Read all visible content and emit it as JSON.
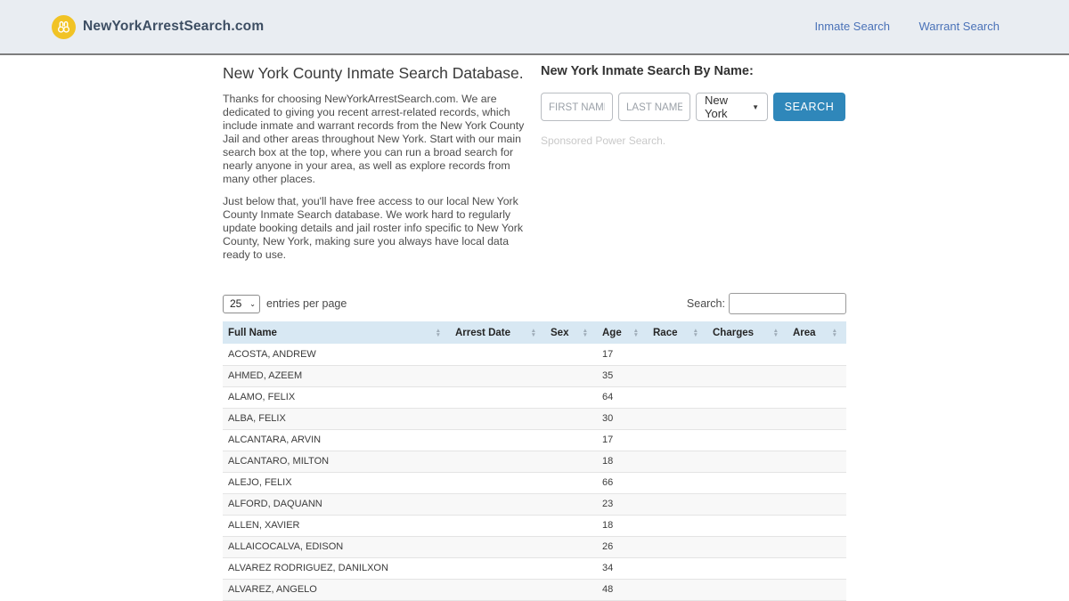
{
  "header": {
    "brand": "NewYorkArrestSearch.com",
    "nav": [
      {
        "label": "Inmate Search"
      },
      {
        "label": "Warrant Search"
      }
    ]
  },
  "intro": {
    "title": "New York County Inmate Search Database.",
    "paragraph1": "Thanks for choosing NewYorkArrestSearch.com. We are dedicated to giving you recent arrest-related records, which include inmate and warrant records from the New York County Jail and other areas throughout New York. Start with our main search box at the top, where you can run a broad search for nearly anyone in your area, as well as explore records from many other places.",
    "paragraph2": "Just below that, you'll have free access to our local New York County Inmate Search database. We work hard to regularly update booking details and jail roster info specific to New York County, New York, making sure you always have local data ready to use."
  },
  "search_form": {
    "title": "New York Inmate Search By Name:",
    "first_name_placeholder": "FIRST NAME",
    "last_name_placeholder": "LAST NAME",
    "state_selected": "New York",
    "search_button": "SEARCH",
    "sponsored": "Sponsored Power Search."
  },
  "table_controls": {
    "page_size": "25",
    "entries_label": "entries per page",
    "search_label": "Search:",
    "search_value": ""
  },
  "table": {
    "columns": [
      "Full Name",
      "Arrest Date",
      "Sex",
      "Age",
      "Race",
      "Charges",
      "Area"
    ],
    "rows": [
      {
        "full_name": "ACOSTA, ANDREW",
        "arrest_date": "",
        "sex": "",
        "age": "17",
        "race": "",
        "charges": "",
        "area": ""
      },
      {
        "full_name": "AHMED, AZEEM",
        "arrest_date": "",
        "sex": "",
        "age": "35",
        "race": "",
        "charges": "",
        "area": ""
      },
      {
        "full_name": "ALAMO, FELIX",
        "arrest_date": "",
        "sex": "",
        "age": "64",
        "race": "",
        "charges": "",
        "area": ""
      },
      {
        "full_name": "ALBA, FELIX",
        "arrest_date": "",
        "sex": "",
        "age": "30",
        "race": "",
        "charges": "",
        "area": ""
      },
      {
        "full_name": "ALCANTARA, ARVIN",
        "arrest_date": "",
        "sex": "",
        "age": "17",
        "race": "",
        "charges": "",
        "area": ""
      },
      {
        "full_name": "ALCANTARO, MILTON",
        "arrest_date": "",
        "sex": "",
        "age": "18",
        "race": "",
        "charges": "",
        "area": ""
      },
      {
        "full_name": "ALEJO, FELIX",
        "arrest_date": "",
        "sex": "",
        "age": "66",
        "race": "",
        "charges": "",
        "area": ""
      },
      {
        "full_name": "ALFORD, DAQUANN",
        "arrest_date": "",
        "sex": "",
        "age": "23",
        "race": "",
        "charges": "",
        "area": ""
      },
      {
        "full_name": "ALLEN, XAVIER",
        "arrest_date": "",
        "sex": "",
        "age": "18",
        "race": "",
        "charges": "",
        "area": ""
      },
      {
        "full_name": "ALLAICOCALVA, EDISON",
        "arrest_date": "",
        "sex": "",
        "age": "26",
        "race": "",
        "charges": "",
        "area": ""
      },
      {
        "full_name": "ALVAREZ RODRIGUEZ, DANILXON",
        "arrest_date": "",
        "sex": "",
        "age": "34",
        "race": "",
        "charges": "",
        "area": ""
      },
      {
        "full_name": "ALVAREZ, ANGELO",
        "arrest_date": "",
        "sex": "",
        "age": "48",
        "race": "",
        "charges": "",
        "area": ""
      }
    ]
  },
  "icons": {
    "logo": "handcuffs-icon",
    "select_caret": "▼",
    "small_caret": "⌄",
    "sort_asc": "▲",
    "sort_desc": "▼"
  },
  "colors": {
    "accent_blue": "#2f87ba",
    "link_blue": "#4a72b8",
    "header_bg": "#e9edf2",
    "table_header_bg": "#d8e8f3",
    "logo_yellow": "#f1c325"
  }
}
